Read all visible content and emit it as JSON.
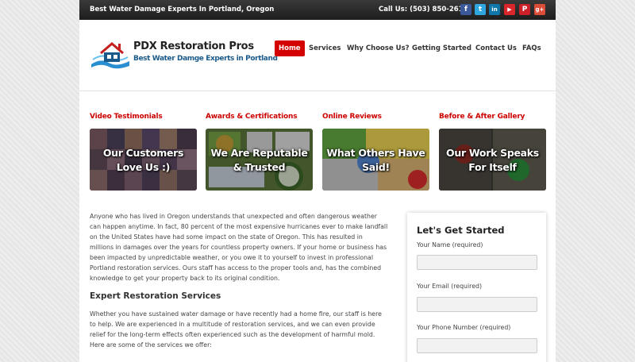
{
  "topbar": {
    "tagline": "Best Water Damage Experts In Portland, Oregon",
    "phone": "Call Us: (503) 850-2610",
    "social": [
      {
        "name": "facebook-icon",
        "glyph": "f",
        "color": "#3b5998"
      },
      {
        "name": "twitter-icon",
        "glyph": "t",
        "color": "#2fa6e0"
      },
      {
        "name": "linkedin-icon",
        "glyph": "in",
        "color": "#0e76a8"
      },
      {
        "name": "youtube-icon",
        "glyph": "▶",
        "color": "#d8262b"
      },
      {
        "name": "pinterest-icon",
        "glyph": "P",
        "color": "#cb2027"
      },
      {
        "name": "google-plus-icon",
        "glyph": "g+",
        "color": "#dd4b39"
      }
    ]
  },
  "logo": {
    "name": "PDX Restoration Pros",
    "subtitle": "Best Water Damge Experts in Portland"
  },
  "nav": {
    "items": [
      "Home",
      "Services",
      "Why Choose Us?",
      "Getting Started",
      "Contact Us",
      "FAQs"
    ],
    "active_color": "#d40000"
  },
  "features": [
    {
      "title": "Video Testimonials",
      "caption": "Our Customers Love Us :)"
    },
    {
      "title": "Awards & Certifications",
      "caption": "We Are Reputable & Trusted"
    },
    {
      "title": "Online Reviews",
      "caption": "What Others Have Said!"
    },
    {
      "title": "Before & After Gallery",
      "caption": "Our Work Speaks For Itself"
    }
  ],
  "main": {
    "intro": "Anyone who has lived in Oregon understands that unexpected and often dangerous weather can happen anytime. In fact, 80 percent of the most expensive hurricanes ever to make landfall on the United States have had some impact on the state of Oregon. This has resulted in millions in damages over the years for countless property owners. If your home or business has been impacted by unpredictable weather, or you owe it to yourself to invest in professional Portland restoration services. Ours staff has access to the proper tools and, has the combined knowledge to get your property back to its original condition.",
    "subheading": "Expert Restoration Services",
    "services_text": "Whether you have sustained water damage or have recently had a home fire, our staff is here to help. We are experienced in a multitude of restoration services, and we can even provide relief for the long-term effects often experienced such as the development of harmful mold. Here are some of the services we offer:"
  },
  "form": {
    "title": "Let's Get Started",
    "fields": [
      {
        "label": "Your Name (required)",
        "value": ""
      },
      {
        "label": "Your Email (required)",
        "value": ""
      },
      {
        "label": "Your Phone Number (required)",
        "value": ""
      }
    ]
  },
  "colors": {
    "accent": "#d40000",
    "section_title": "#cc0000",
    "brand_blue": "#1a5a8a"
  }
}
